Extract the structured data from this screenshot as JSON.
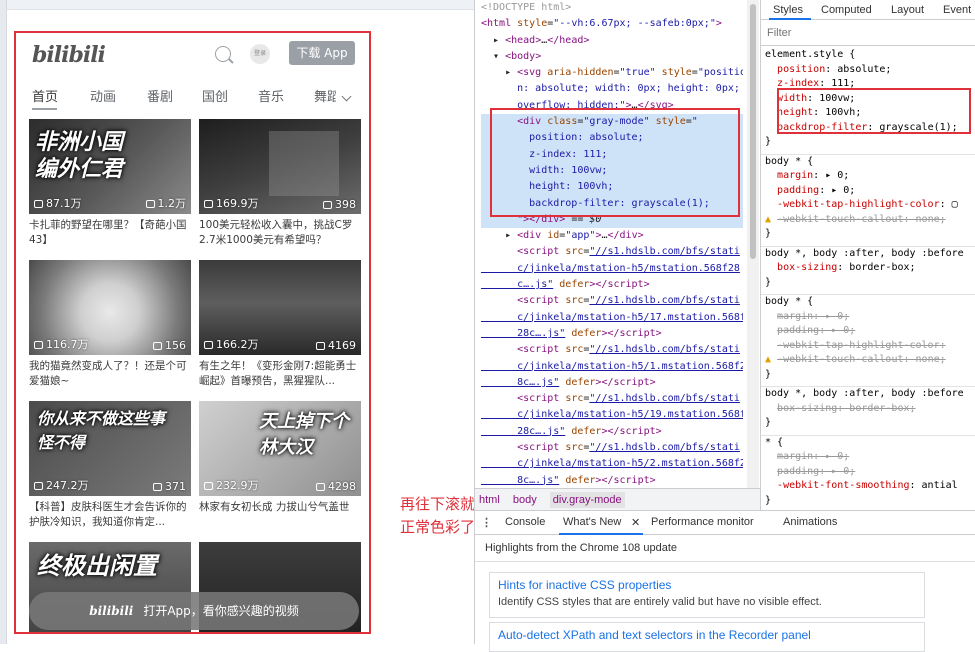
{
  "mobile": {
    "logo": "bilibili",
    "login_label": "登录",
    "download_label": "下载 App",
    "tabs": [
      "首页",
      "动画",
      "番剧",
      "国创",
      "音乐",
      "舞蹈"
    ],
    "cards": [
      {
        "overlay": "非洲小国\n编外仁君",
        "views": "87.1万",
        "comments": "1.2万",
        "title": "卡扎菲的野望在哪里？【奇葩小国43】"
      },
      {
        "overlay": "",
        "views": "169.9万",
        "comments": "398",
        "title": "100美元轻松收入囊中，挑战C罗2.7米1000美元有希望吗？"
      },
      {
        "overlay": "",
        "views": "116.7万",
        "comments": "156",
        "title": "我的猫竟然变成人了？！还是个可爱猫娘~"
      },
      {
        "overlay": "",
        "views": "166.2万",
        "comments": "4169",
        "title": "有生之年！《变形金刚7:超能勇士崛起》首曝预告，黑猩猩队..."
      },
      {
        "overlay": "你从来不做这些事\n怪不得",
        "views": "247.2万",
        "comments": "371",
        "title": "【科普】皮肤科医生才会告诉你的护肤冷知识，我知道你肯定..."
      },
      {
        "overlay": "天上掉下个\n林大汉",
        "views": "232.9万",
        "comments": "4298",
        "title": "林家有女初长成 力拔山兮气盖世"
      },
      {
        "overlay": "终极出闲置",
        "views": "",
        "comments": "",
        "title": ""
      },
      {
        "overlay": "",
        "views": "",
        "comments": "",
        "title": ""
      }
    ],
    "open_app": "打开App，看你感兴趣的视频"
  },
  "annotation": "再往下滚就是正常色彩了。",
  "devtools": {
    "breadcrumbs": [
      "html",
      "body",
      "div.gray-mode"
    ],
    "style_tabs": [
      "Styles",
      "Computed",
      "Layout",
      "Event"
    ],
    "filter_placeholder": "Filter",
    "drawer_tabs": [
      "Console",
      "What's New",
      "Performance monitor",
      "Animations"
    ],
    "highlights": "Highlights from the Chrome 108 update",
    "news": [
      {
        "title": "Hints for inactive CSS properties",
        "desc": "Identify CSS styles that are entirely valid but have no visible effect."
      },
      {
        "title": "Auto-detect XPath and text selectors in the Recorder panel",
        "desc": ""
      }
    ]
  }
}
